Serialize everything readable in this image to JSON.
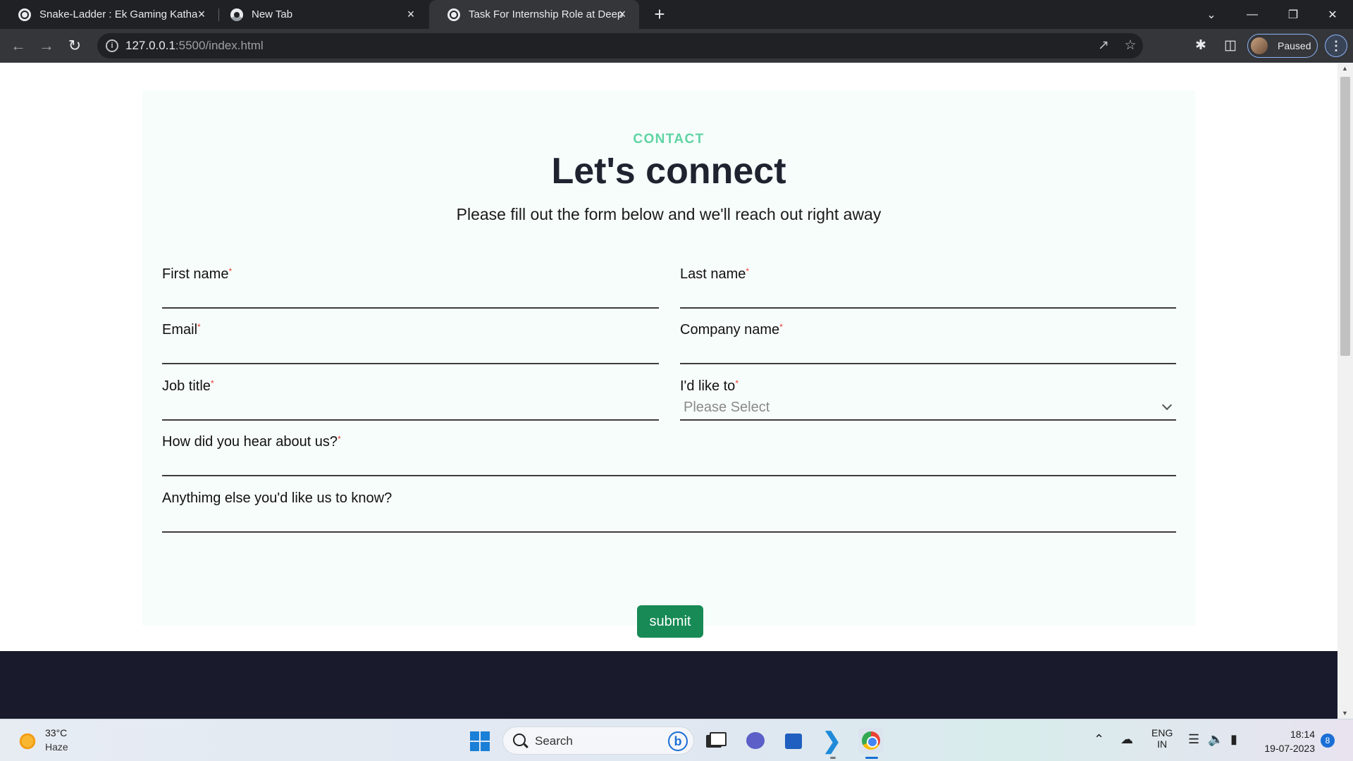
{
  "browser": {
    "tabs": [
      {
        "title": "Snake-Ladder : Ek Gaming Katha",
        "icon": "globe-icon",
        "active": false
      },
      {
        "title": "New Tab",
        "icon": "chrome-icon",
        "active": false
      },
      {
        "title": "Task For Internship Role at DeepS",
        "icon": "globe-icon",
        "active": true
      }
    ],
    "address": {
      "host": "127.0.0.1",
      "rest": ":5500/index.html"
    },
    "profile_label": "Paused"
  },
  "page": {
    "eyebrow": "CONTACT",
    "headline": "Let's connect",
    "subhead": "Please fill out the form below and we'll reach out right away",
    "form": {
      "required_marker": "*",
      "fields": {
        "first_name": "First name",
        "last_name": "Last name",
        "email": "Email",
        "company_name": "Company name",
        "job_title": "Job title",
        "id_like_to": "I'd like to",
        "id_like_to_value": "Please Select",
        "hear_about": "How did you hear about us?",
        "anything_else": "Anythimg else you'd like us to know?"
      },
      "submit_label": "submit"
    }
  },
  "taskbar": {
    "weather": {
      "temp": "33°C",
      "desc": "Haze"
    },
    "search_label": "Search",
    "language": {
      "line1": "ENG",
      "line2": "IN"
    },
    "clock": {
      "time": "18:14",
      "date": "19-07-2023"
    },
    "notification_count": "8"
  }
}
